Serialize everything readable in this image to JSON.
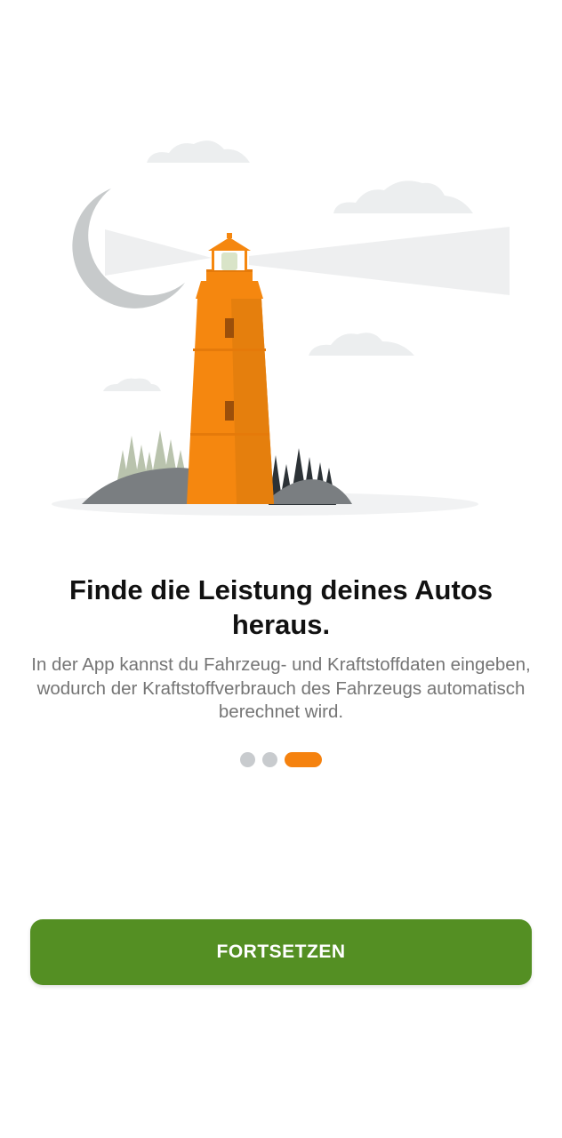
{
  "onboarding": {
    "title": "Finde die Leistung deines Autos heraus.",
    "description": "In der App kannst du Fahrzeug- und Kraftstoffdaten eingeben, wodurch der Kraftstoffverbrauch des Fahrzeugs automatisch berechnet wird.",
    "pagination": {
      "total": 3,
      "active_index": 2
    },
    "continue_label": "FORTSETZEN"
  },
  "illustration": {
    "subject": "lighthouse-at-night",
    "icons": [
      "moon-icon",
      "cloud-icon",
      "lighthouse-icon",
      "trees-icon"
    ]
  },
  "colors": {
    "accent": "#f5820f",
    "button": "#548f23",
    "dot_inactive": "#c8cbce",
    "title_text": "#111111",
    "body_text": "#757575"
  }
}
